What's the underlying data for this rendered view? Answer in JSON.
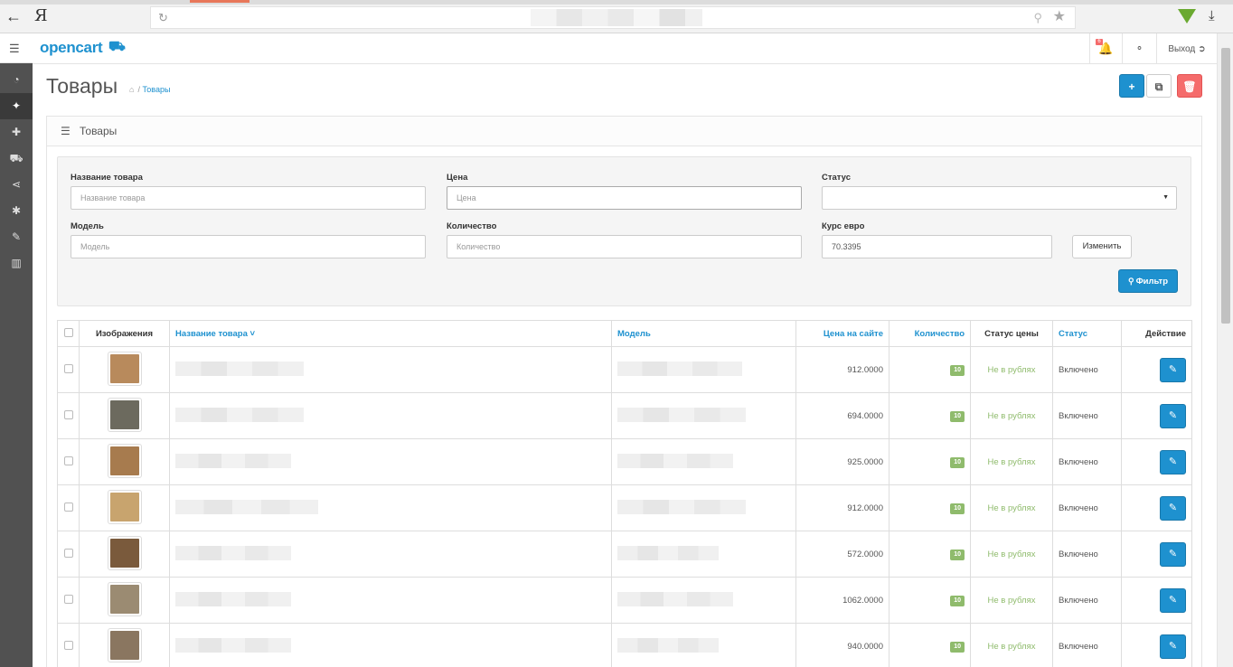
{
  "browser": {
    "back_icon": "arrow-left-icon",
    "brand_letter": "Я",
    "reload_icon": "reload-icon",
    "search_icon": "search-icon",
    "star_icon": "star-icon",
    "download_icon": "download-icon"
  },
  "sidebar": {
    "items": [
      {
        "icon": "dashboard-icon",
        "glyph": "◔"
      },
      {
        "icon": "tag-icon",
        "glyph": "✦"
      },
      {
        "icon": "puzzle-icon",
        "glyph": "✚"
      },
      {
        "icon": "cart-icon",
        "glyph": "⛟"
      },
      {
        "icon": "share-icon",
        "glyph": "⋖"
      },
      {
        "icon": "gear-icon",
        "glyph": "✱"
      },
      {
        "icon": "wrench-icon",
        "glyph": "✎"
      },
      {
        "icon": "bar-chart-icon",
        "glyph": "▥"
      }
    ]
  },
  "header": {
    "logo_text": "opencart",
    "notifications_count": "6",
    "logout_label": "Выход"
  },
  "page": {
    "title": "Товары",
    "breadcrumb_item": "Товары",
    "breadcrumb_separator": "/"
  },
  "panel": {
    "heading": "Товары"
  },
  "filter": {
    "name_label": "Название товара",
    "name_placeholder": "Название товара",
    "price_label": "Цена",
    "price_placeholder": "Цена",
    "status_label": "Статус",
    "status_value": "",
    "model_label": "Модель",
    "model_placeholder": "Модель",
    "quantity_label": "Количество",
    "quantity_placeholder": "Количество",
    "euro_label": "Курс евро",
    "euro_value": "70.3395",
    "change_button": "Изменить",
    "filter_button": "Фильтр"
  },
  "table": {
    "columns": {
      "image": "Изображения",
      "name": "Название товара",
      "model": "Модель",
      "price": "Цена на сайте",
      "quantity": "Количество",
      "price_status": "Статус цены",
      "status": "Статус",
      "action": "Действие"
    },
    "rows": [
      {
        "price": "912.0000",
        "quantity": "10",
        "price_status": "Не в рублях",
        "status": "Включено",
        "thumb_color": "#b88a5c"
      },
      {
        "price": "694.0000",
        "quantity": "10",
        "price_status": "Не в рублях",
        "status": "Включено",
        "thumb_color": "#6c6a5e"
      },
      {
        "price": "925.0000",
        "quantity": "10",
        "price_status": "Не в рублях",
        "status": "Включено",
        "thumb_color": "#a77b4e"
      },
      {
        "price": "912.0000",
        "quantity": "10",
        "price_status": "Не в рублях",
        "status": "Включено",
        "thumb_color": "#c8a46e"
      },
      {
        "price": "572.0000",
        "quantity": "10",
        "price_status": "Не в рублях",
        "status": "Включено",
        "thumb_color": "#7a5a3c"
      },
      {
        "price": "1062.0000",
        "quantity": "10",
        "price_status": "Не в рублях",
        "status": "Включено",
        "thumb_color": "#9b8b72"
      },
      {
        "price": "940.0000",
        "quantity": "10",
        "price_status": "Не в рублях",
        "status": "Включено",
        "thumb_color": "#8a7660"
      }
    ]
  },
  "colors": {
    "primary": "#1e91cf",
    "danger": "#f56b6b",
    "success": "#8fbb6c",
    "sidebar": "#515151"
  }
}
